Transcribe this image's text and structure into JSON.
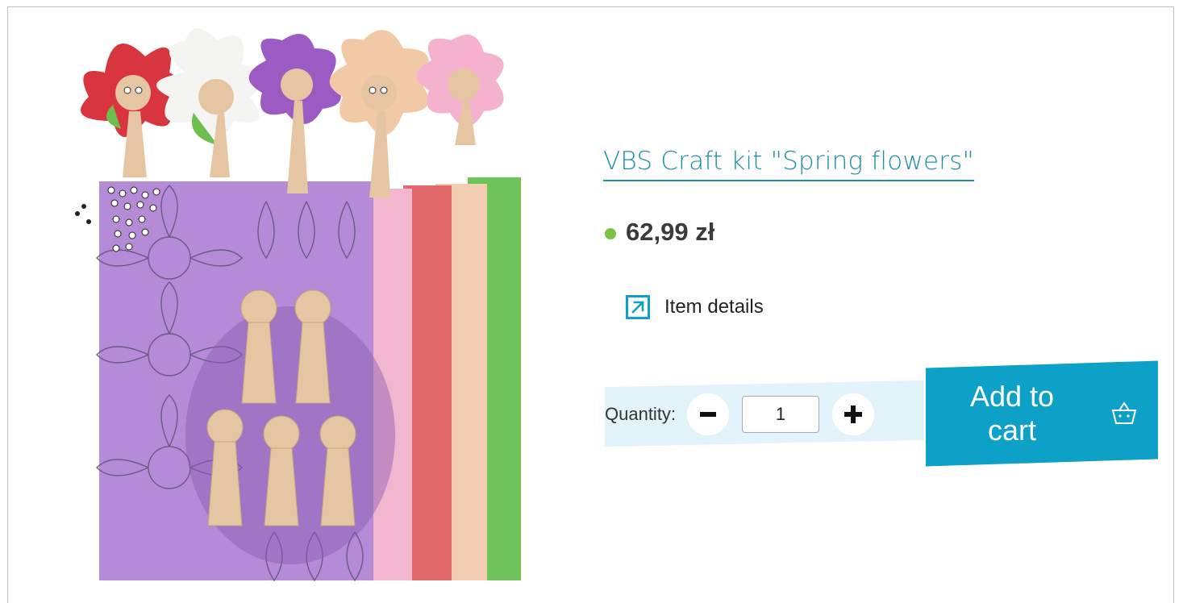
{
  "product": {
    "title": "VBS Craft kit \"Spring flowers\"",
    "price": "62,99 zł",
    "stock_color": "#7cc142",
    "details_label": "Item details",
    "details_icon": "external-link-icon"
  },
  "cart": {
    "quantity_label": "Quantity:",
    "quantity_value": "1",
    "minus_icon": "minus-icon",
    "plus_icon": "plus-icon",
    "add_line1": "Add to",
    "add_line2": "cart",
    "basket_icon": "basket-icon",
    "accent_color": "#0ea1c7",
    "link_color": "#1f8fa6"
  }
}
